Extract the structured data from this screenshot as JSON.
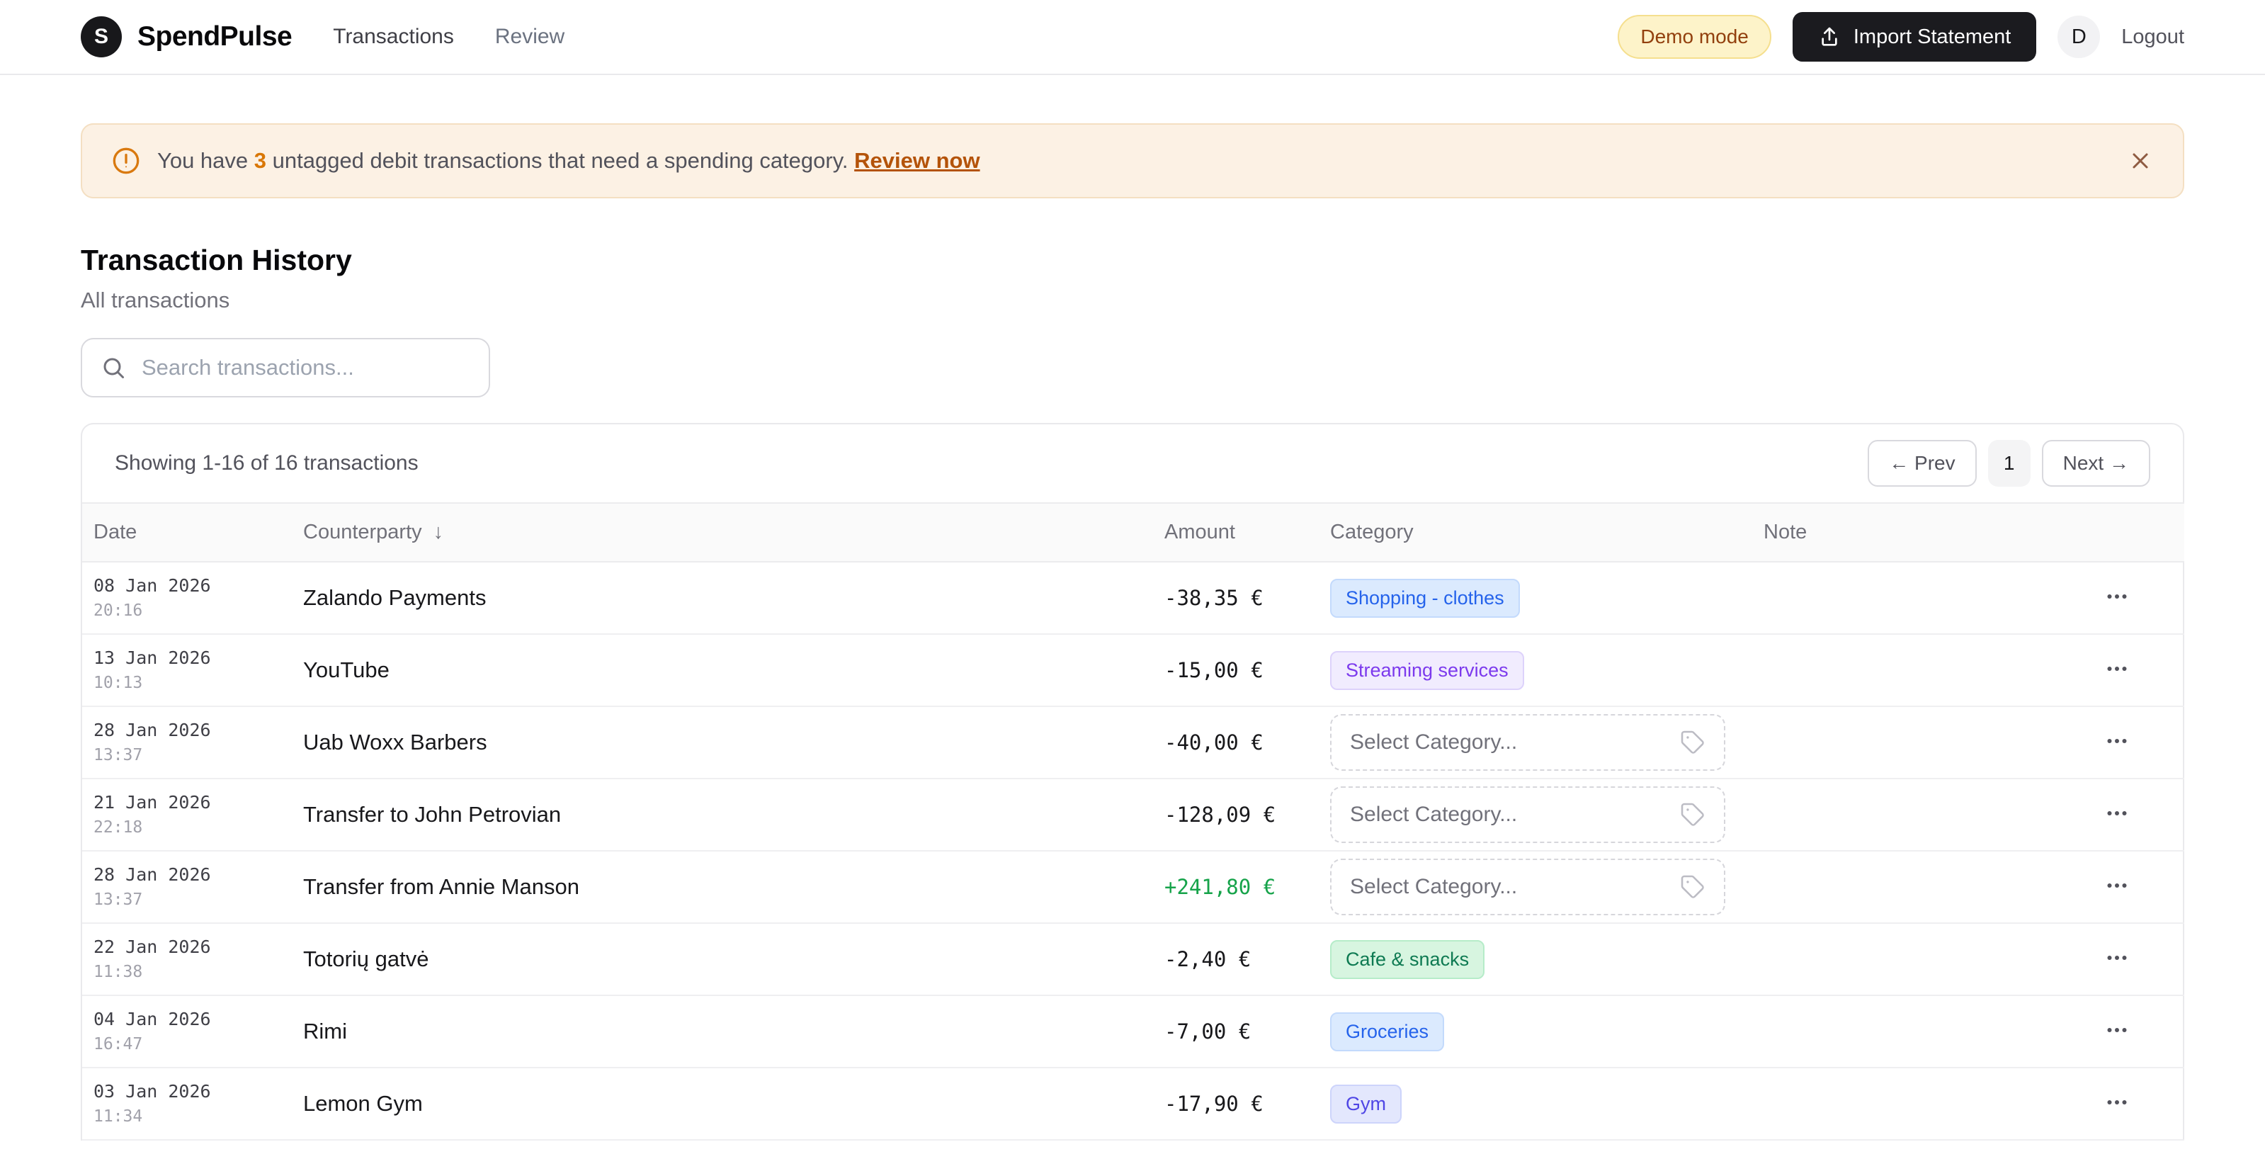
{
  "header": {
    "brand": {
      "initial": "S",
      "name": "SpendPulse"
    },
    "nav": {
      "transactions": "Transactions",
      "review": "Review"
    },
    "demo_badge": "Demo mode",
    "import_button": "Import Statement",
    "avatar_initial": "D",
    "logout": "Logout"
  },
  "alert": {
    "prefix": "You have ",
    "count": "3",
    "suffix": " untagged debit transactions that need a spending category. ",
    "link": "Review now"
  },
  "page": {
    "title": "Transaction History",
    "subtitle": "All transactions"
  },
  "search": {
    "placeholder": "Search transactions..."
  },
  "table_card": {
    "summary": "Showing 1-16 of 16 transactions",
    "pagination": {
      "prev": "← Prev",
      "page": "1",
      "next": "Next →"
    },
    "columns": {
      "date": "Date",
      "counterparty": "Counterparty",
      "amount": "Amount",
      "category": "Category",
      "note": "Note"
    },
    "sort": {
      "column": "Counterparty",
      "direction_icon": "↓"
    },
    "select_placeholder": "Select Category...",
    "rows": [
      {
        "date": "08 Jan 2026",
        "time": "20:16",
        "counterparty": "Zalando Payments",
        "amount": "-38,35 €",
        "sign": "negative",
        "category": {
          "type": "badge",
          "label": "Shopping - clothes",
          "color": "blue"
        },
        "note": ""
      },
      {
        "date": "13 Jan 2026",
        "time": "10:13",
        "counterparty": "YouTube",
        "amount": "-15,00 €",
        "sign": "negative",
        "category": {
          "type": "badge",
          "label": "Streaming services",
          "color": "violet"
        },
        "note": ""
      },
      {
        "date": "28 Jan 2026",
        "time": "13:37",
        "counterparty": "Uab Woxx Barbers",
        "amount": "-40,00 €",
        "sign": "negative",
        "category": {
          "type": "select"
        },
        "note": ""
      },
      {
        "date": "21 Jan 2026",
        "time": "22:18",
        "counterparty": "Transfer to John Petrovian",
        "amount": "-128,09 €",
        "sign": "negative",
        "category": {
          "type": "select"
        },
        "note": ""
      },
      {
        "date": "28 Jan 2026",
        "time": "13:37",
        "counterparty": "Transfer from Annie Manson",
        "amount": "+241,80 €",
        "sign": "positive",
        "category": {
          "type": "select"
        },
        "note": ""
      },
      {
        "date": "22 Jan 2026",
        "time": "11:38",
        "counterparty": "Totorių gatvė",
        "amount": "-2,40 €",
        "sign": "negative",
        "category": {
          "type": "badge",
          "label": "Cafe & snacks",
          "color": "green"
        },
        "note": ""
      },
      {
        "date": "04 Jan 2026",
        "time": "16:47",
        "counterparty": "Rimi",
        "amount": "-7,00 €",
        "sign": "negative",
        "category": {
          "type": "badge",
          "label": "Groceries",
          "color": "blue"
        },
        "note": ""
      },
      {
        "date": "03 Jan 2026",
        "time": "11:34",
        "counterparty": "Lemon Gym",
        "amount": "-17,90 €",
        "sign": "negative",
        "category": {
          "type": "badge",
          "label": "Gym",
          "color": "indigo"
        },
        "note": ""
      }
    ]
  },
  "colors": {
    "positive_amount": "#16a34a",
    "alert_bg": "#fcf1e4",
    "alert_accent": "#d97706",
    "alert_link": "#b45309",
    "badge_palette": {
      "blue": {
        "bg": "#dbeafe",
        "text": "#2563eb",
        "border": "#c3dafc"
      },
      "violet": {
        "bg": "#f1ecfe",
        "text": "#7c3aed",
        "border": "#ddd2fb"
      },
      "green": {
        "bg": "#d7f5e0",
        "text": "#0e7a52",
        "border": "#b6ecc9"
      },
      "indigo": {
        "bg": "#e3e7fd",
        "text": "#4f46e5",
        "border": "#cdd4fb"
      }
    }
  }
}
